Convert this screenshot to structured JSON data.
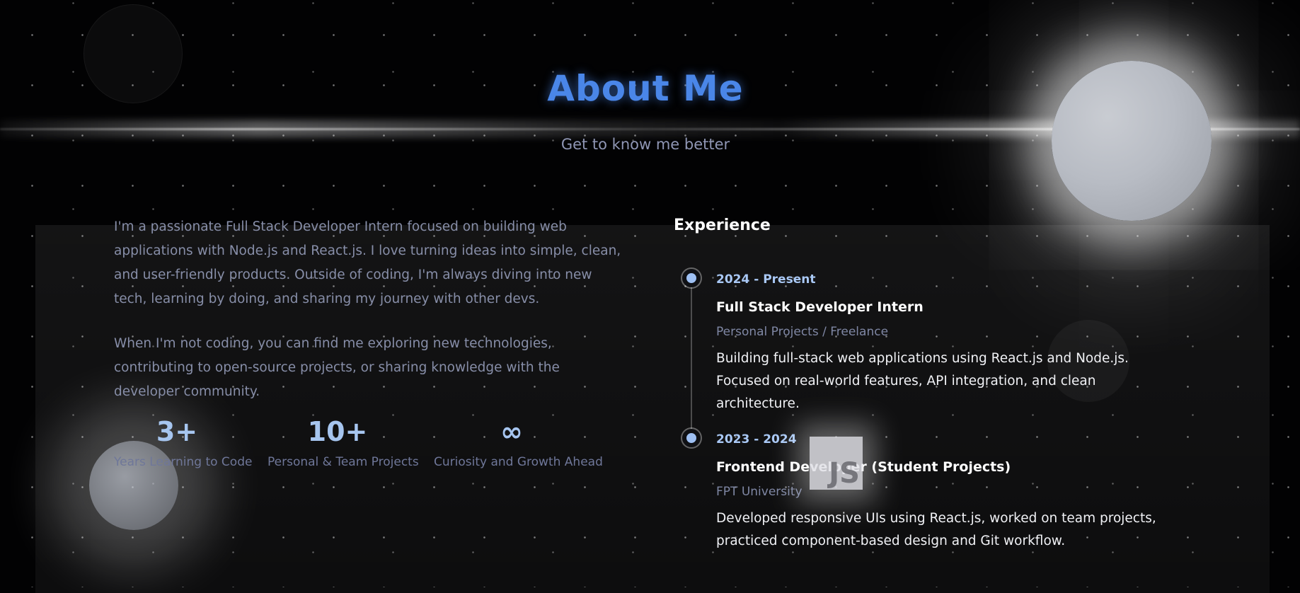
{
  "header": {
    "title": "About Me",
    "subtitle": "Get to know me better"
  },
  "about": {
    "paragraphs": [
      "I'm a passionate Full Stack Developer Intern focused on building web applications with Node.js and React.js. I love turning ideas into simple, clean, and user-friendly products. Outside of coding, I'm always diving into new tech, learning by doing, and sharing my journey with other devs.",
      "When I'm not coding, you can find me exploring new technologies, contributing to open-source projects, or sharing knowledge with the developer community."
    ],
    "stats": [
      {
        "value": "3+",
        "label": "Years Learning to Code"
      },
      {
        "value": "10+",
        "label": "Personal & Team Projects"
      },
      {
        "value": "∞",
        "label": "Curiosity and Growth Ahead"
      }
    ]
  },
  "experience": {
    "heading": "Experience",
    "items": [
      {
        "date": "2024 - Present",
        "role": "Full Stack Developer Intern",
        "org": "Personal Projects / Freelance",
        "desc": "Building full-stack web applications using React.js and Node.js. Focused on real-world features, API integration, and clean architecture."
      },
      {
        "date": "2023 - 2024",
        "role": "Frontend Developer (Student Projects)",
        "org": "FPT University",
        "desc": "Developed responsive UIs using React.js, worked on team projects, practiced component-based design and Git workflow."
      }
    ]
  },
  "decor": {
    "js_badge": "JS",
    "accent_color": "#4a86e8"
  }
}
